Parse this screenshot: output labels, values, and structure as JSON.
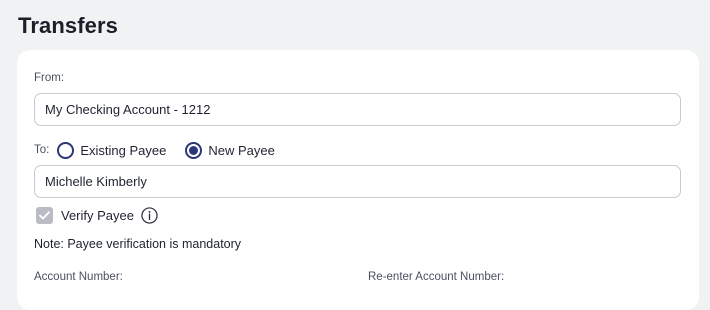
{
  "page": {
    "title": "Transfers"
  },
  "from": {
    "label": "From:",
    "value": "My Checking Account - 1212"
  },
  "to": {
    "label": "To:",
    "options": [
      {
        "label": "Existing Payee",
        "selected": false
      },
      {
        "label": "New Payee",
        "selected": true
      }
    ],
    "payee_name": "Michelle Kimberly"
  },
  "verify": {
    "label": "Verify Payee",
    "checked": true,
    "disabled": true,
    "icon": "info-icon"
  },
  "note": "Note: Payee verification is mandatory",
  "account": {
    "number_label": "Account Number:",
    "reenter_label": "Re-enter Account Number:"
  },
  "colors": {
    "accent": "#2a3778",
    "background": "#f1f2f4",
    "card": "#ffffff",
    "checkbox_disabled": "#b9bcc3"
  }
}
